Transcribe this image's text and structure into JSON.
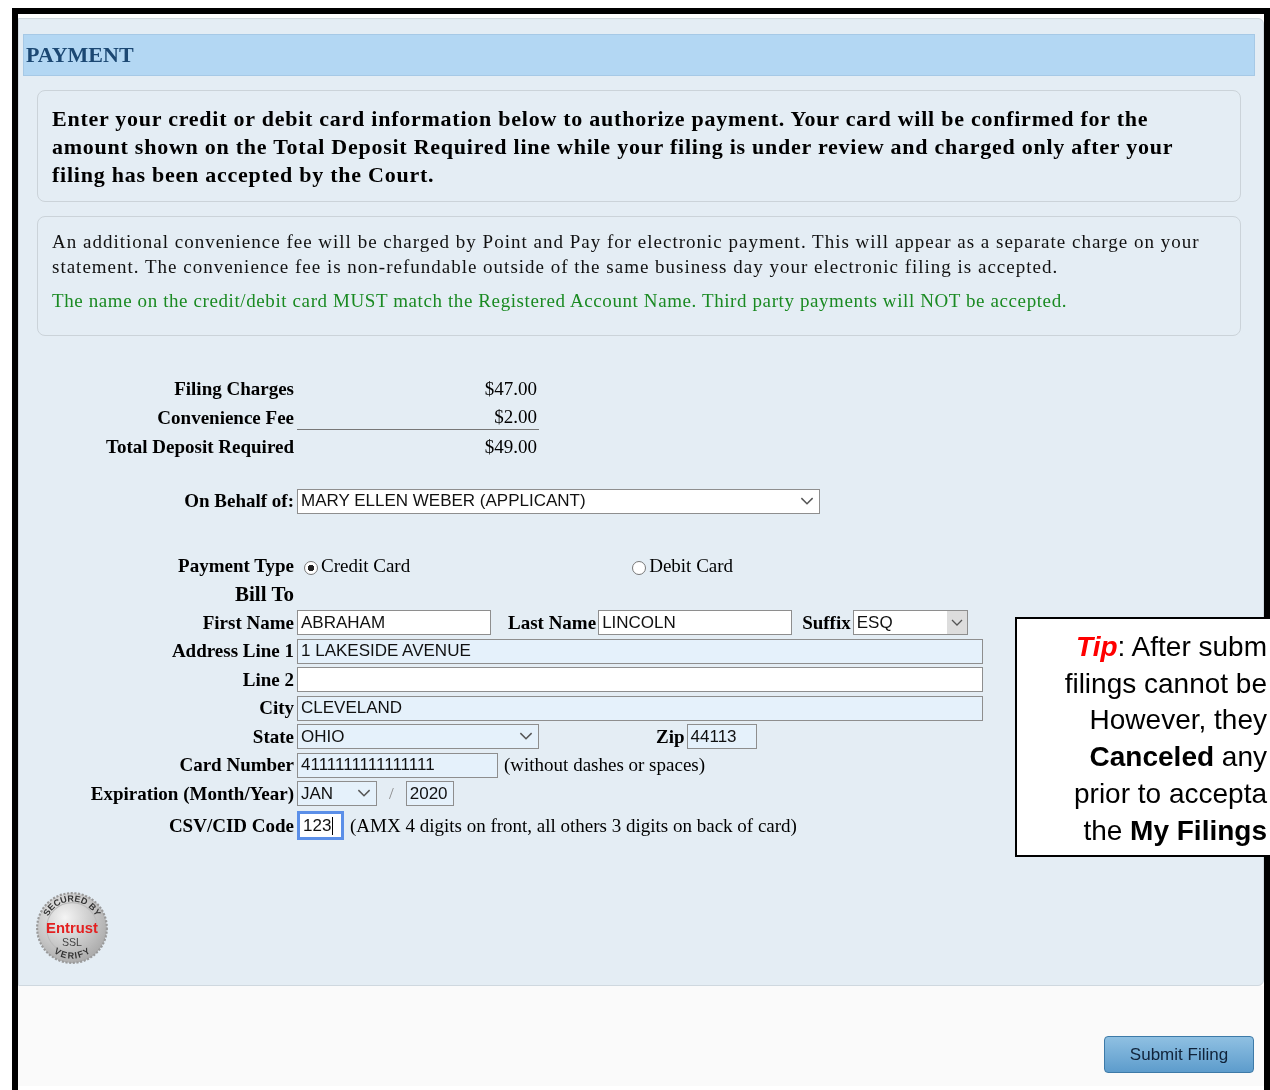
{
  "section_title": "PAYMENT",
  "notice": "Enter your credit or debit card information below to authorize payment. Your card will be confirmed for the amount shown on the Total Deposit Required line while your filing is under review and charged only after your filing has been accepted by the Court.",
  "fee_note": "An additional convenience fee will be charged by Point and Pay for electronic payment. This will appear as a separate charge on your statement. The convenience fee is non-refundable outside of the same business day your electronic filing is accepted.",
  "warning": "The name on the credit/debit card MUST match the Registered Account Name. Third party payments will NOT be accepted.",
  "charges": [
    {
      "label": "Filing Charges",
      "amount": "$47.00",
      "kind": "item"
    },
    {
      "label": "Convenience Fee",
      "amount": "$2.00",
      "kind": "subtotal"
    },
    {
      "label": "Total Deposit Required",
      "amount": "$49.00",
      "kind": "total"
    }
  ],
  "on_behalf": {
    "label": "On Behalf of:",
    "value": "MARY ELLEN WEBER (APPLICANT)"
  },
  "payment_type": {
    "label": "Payment Type",
    "options": [
      {
        "label": "Credit Card",
        "selected": true
      },
      {
        "label": "Debit Card",
        "selected": false
      }
    ]
  },
  "bill_to": "Bill To",
  "first_name": {
    "label": "First Name",
    "value": "ABRAHAM",
    "autofilled": false
  },
  "last_name": {
    "label": "Last Name",
    "value": "LINCOLN",
    "autofilled": false
  },
  "suffix": {
    "label": "Suffix",
    "value": "ESQ"
  },
  "address1": {
    "label": "Address Line 1",
    "value": "1 LAKESIDE AVENUE",
    "autofilled": true
  },
  "address2": {
    "label": "Line 2",
    "autofilled": false
  },
  "city": {
    "label": "City",
    "value": "CLEVELAND",
    "autofilled": true
  },
  "state": {
    "label": "State",
    "value": "OHIO",
    "autofilled": true
  },
  "zip": {
    "label": "Zip",
    "value": "44113",
    "autofilled": true
  },
  "card_number": {
    "label": "Card Number",
    "value": "4111111111111111",
    "autofilled": true,
    "hint": "(without dashes or spaces)"
  },
  "expiration": {
    "label": "Expiration (Month/Year)",
    "month": "JAN",
    "separator": "/",
    "year": "2020",
    "autofilled": true
  },
  "csv": {
    "label": "CSV/CID Code",
    "value": "123",
    "focused": true,
    "hint": "(AMX 4 digits on front, all others 3 digits on back of card)"
  },
  "seal": {
    "top": "SECURED BY",
    "brand": "Entrust",
    "middle": "SSL",
    "bottom": "VERIFY"
  },
  "tip": {
    "lines": [
      [
        {
          "kind": "label",
          "text": "Tip"
        },
        {
          "kind": "plain",
          "text": ": After subm"
        }
      ],
      [
        {
          "kind": "plain",
          "text": "filings cannot be"
        }
      ],
      [
        {
          "kind": "plain",
          "text": "However, they"
        }
      ],
      [
        {
          "kind": "bold",
          "text": "Canceled"
        },
        {
          "kind": "plain",
          "text": " any"
        }
      ],
      [
        {
          "kind": "plain",
          "text": "prior to accepta"
        }
      ],
      [
        {
          "kind": "plain",
          "text": "the "
        },
        {
          "kind": "bold",
          "text": "My Filings"
        }
      ]
    ]
  },
  "submit_button": "Submit Filing"
}
